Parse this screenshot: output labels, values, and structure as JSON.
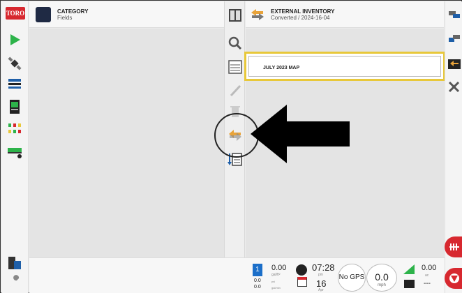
{
  "brand": {
    "logo_text": "TORO"
  },
  "category": {
    "title": "CATEGORY",
    "subtitle": "Fields"
  },
  "external_inventory": {
    "title": "EXTERNAL INVENTORY",
    "subtitle": "Converted / 2024-16-04"
  },
  "list": {
    "items": [
      {
        "label": "JULY 2023 MAP",
        "selected": true
      }
    ]
  },
  "left_sidebar": {
    "icons": [
      "play-icon",
      "satellite-icon",
      "data-list-icon",
      "console-icon",
      "sprayer-nozzles-icon",
      "implement-icon",
      "device-stack-icon",
      "wrench-icon"
    ]
  },
  "right_sidebar": {
    "icons": [
      "transfer-icon",
      "export-icon",
      "external-inventory-icon",
      "tools-icon",
      "boom-sections-icon",
      "toro-button-icon"
    ]
  },
  "tools": {
    "icons": [
      "split-view-icon",
      "search-icon",
      "details-icon",
      "edit-icon",
      "delete-icon",
      "convert-icon",
      "import-icon"
    ]
  },
  "status": {
    "rate_box": "1",
    "rate_value": "0.00",
    "rate_unit": "gal/ft²",
    "flow_value": "0.0",
    "flow_unit": "psi",
    "volume_value": "0.0",
    "volume_unit": "gal/min",
    "time": "07:28",
    "ampm": "pm",
    "day": "16",
    "month": "Apr",
    "gps": "No GPS",
    "speed": "0.0",
    "speed_unit": "mph",
    "area_value": "0.00",
    "area_unit": "ac",
    "dash": "---"
  },
  "colors": {
    "accent_red": "#d7282f",
    "highlight_yellow": "#e8c83a",
    "rate_blue": "#1c6fc9"
  }
}
